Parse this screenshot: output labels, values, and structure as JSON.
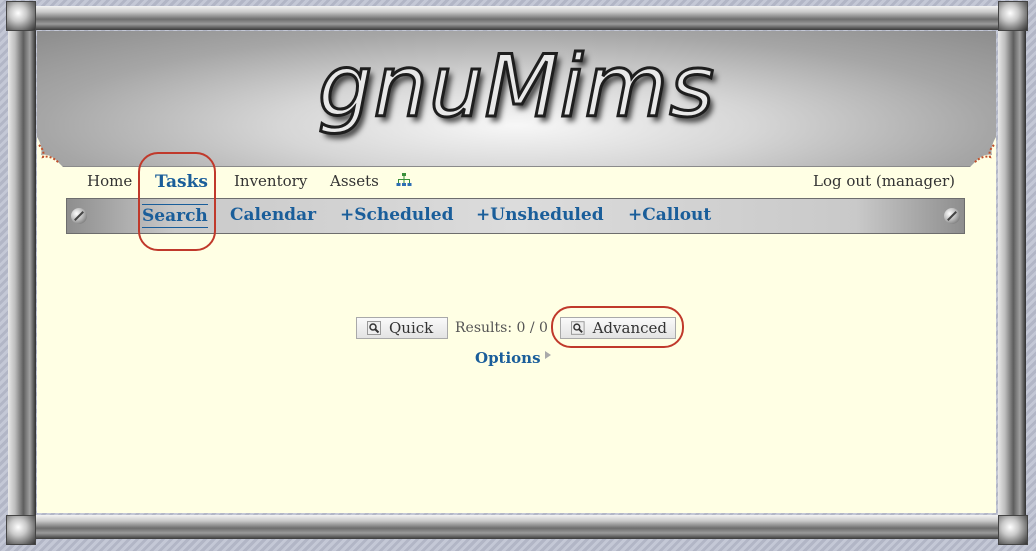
{
  "app": {
    "logo_text": "gnuMims"
  },
  "topnav": {
    "items": [
      {
        "label": "Home"
      },
      {
        "label": "Tasks"
      },
      {
        "label": "Inventory"
      },
      {
        "label": "Assets"
      }
    ],
    "sitemap_icon": "sitemap-icon",
    "logout_label": "Log out (manager)"
  },
  "subnav": {
    "items": [
      {
        "label": "Search"
      },
      {
        "label": "Calendar"
      },
      {
        "label": "+Scheduled"
      },
      {
        "label": "+Unsheduled"
      },
      {
        "label": "+Callout"
      }
    ]
  },
  "search": {
    "quick_label": "Quick",
    "results_text": "Results: 0 / 0",
    "advanced_label": "Advanced",
    "options_label": "Options"
  },
  "colors": {
    "link": "#1a5e9a",
    "background": "#ffffe4",
    "highlight_circle": "#c0392b"
  }
}
